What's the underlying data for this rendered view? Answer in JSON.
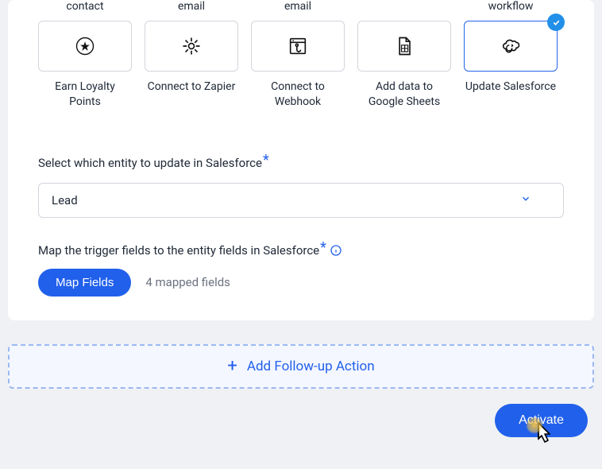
{
  "partial_labels": [
    "contact",
    "email",
    "email",
    "",
    "workflow"
  ],
  "action_tiles": [
    {
      "id": "earn-loyalty",
      "label": "Earn Loyalty Points",
      "icon": "star-icon",
      "selected": false
    },
    {
      "id": "zapier",
      "label": "Connect to Zapier",
      "icon": "zapier-icon",
      "selected": false
    },
    {
      "id": "webhook",
      "label": "Connect to Webhook",
      "icon": "webhook-icon",
      "selected": false
    },
    {
      "id": "google-sheets",
      "label": "Add data to Google Sheets",
      "icon": "sheets-icon",
      "selected": false
    },
    {
      "id": "salesforce",
      "label": "Update Salesforce",
      "icon": "salesforce-icon",
      "selected": true
    }
  ],
  "entity_section": {
    "label": "Select which entity to update in Salesforce",
    "selected": "Lead"
  },
  "map_section": {
    "label": "Map the trigger fields to the entity fields in Salesforce",
    "button_label": "Map Fields",
    "count_label": "4 mapped fields"
  },
  "follow_up_label": "Add Follow-up Action",
  "activate_label": "Activate",
  "colors": {
    "primary": "#2160eb",
    "badge": "#2290e9",
    "border": "#d1d5db"
  }
}
